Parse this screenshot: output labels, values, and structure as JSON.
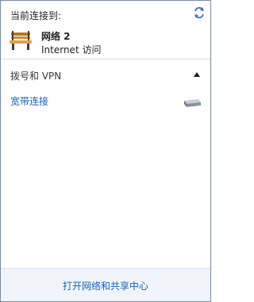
{
  "header": {
    "current_label": "当前连接到:",
    "refresh_icon": "refresh-icon"
  },
  "connection": {
    "icon": "bench-network-icon",
    "name": "网络  2",
    "status": "Internet 访问"
  },
  "section": {
    "title": "拨号和 VPN",
    "expanded": true
  },
  "items": [
    {
      "label": "宽带连接",
      "icon": "modem-icon"
    }
  ],
  "footer": {
    "link_label": "打开网络和共享中心"
  },
  "colors": {
    "link": "#1a60b5",
    "footer_bg": "#f1f5fb",
    "border": "#7a8a9c"
  }
}
